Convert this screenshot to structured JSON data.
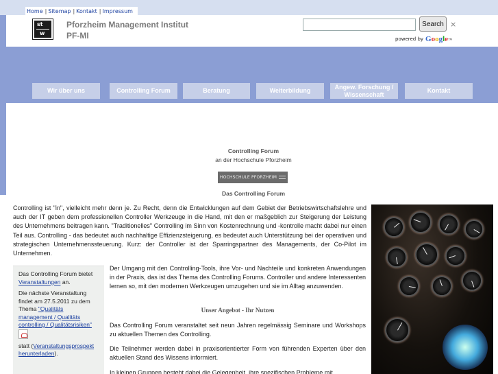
{
  "toplinks": [
    "Home",
    "Sitemap",
    "Kontakt",
    "Impressum"
  ],
  "header": {
    "logo_text_1": "st",
    "logo_text_2": "w",
    "title_line1": "Pforzheim Management Institut",
    "title_line2": "PF-MI",
    "search_placeholder": "",
    "search_button": "Search",
    "search_close": "×",
    "powered_by": "powered by",
    "google": "Google™"
  },
  "nav": [
    "Wir über uns",
    "Controlling Forum",
    "Beratung",
    "Weiterbildung",
    "Angew. Forschung / Wissenschaft",
    "Kontakt"
  ],
  "content": {
    "heading1": "Controlling Forum",
    "heading2": "an der Hochschule Pforzheim",
    "badge": "HOCHSCHULE PFORZHEIM",
    "section_title": "Das Controlling Forum",
    "intro": "Controlling ist \"in\", vielleicht mehr denn je. Zu Recht, denn die Entwicklungen auf dem Gebiet der Betriebswirtschaftslehre und auch der IT geben dem professionellen Controller Werkzeuge in die Hand, mit den er maßgeblich zur Steigerung der Leistung des Unternehmens beitragen kann. \"Traditionelles\" Controlling im Sinn von Kostenrechnung und -kontrolle macht dabei nur einen Teil aus. Controlling - das bedeutet auch nachhaltige Effizienzsteigerung, es bedeutet auch Unterstützung bei der operativen und strategischen Unternehmenssteuerung. Kurz: der Controller ist der Sparringspartner des Managements, der Co-Pilot im Unternehmen.",
    "para2": "Der Umgang mit den Controlling-Tools, ihre Vor- und Nachteile und konkreten Anwendungen in der Praxis, das ist das Thema des Controlling Forums. Controller und andere Interessenten lernen so, mit den modernen Werkzeugen umzugehen und sie im Alltag anzuwenden.",
    "offer_title": "Unser Angebot - Ihr Nutzen",
    "para3": "Das Controlling Forum veranstaltet seit neun Jahren regelmässig Seminare und Workshops zu aktuellen Themen des Controlling.",
    "para4": "Die Teilnehmer werden dabei in praxisorientierter Form von führenden Experten über den aktuellen Stand des Wissens informiert.",
    "para5": "In kleinen Gruppen besteht dabei die Gelegenheit, ihre spezifischen Probleme mit"
  },
  "sidebox": {
    "p1_text": "Das Controlling Forum bietet",
    "p1_link": "Veranstaltungen",
    "p1_end": "an.",
    "p2_text": "Die nächste Veranstaltung findet am 27.5.2011 zu dem Thema",
    "p2_link": "\"Qualitäts management / Qualitäts controlling / Qualitätsrisiken\"",
    "p3_text": "statt (",
    "p3_link": "Veranstaltungsprospekt herunterladen",
    "p3_end": ")."
  },
  "colors": {
    "nav_band": "#8b9ed4",
    "nav_button": "#c6cfe8",
    "link": "#1a3fa0"
  }
}
